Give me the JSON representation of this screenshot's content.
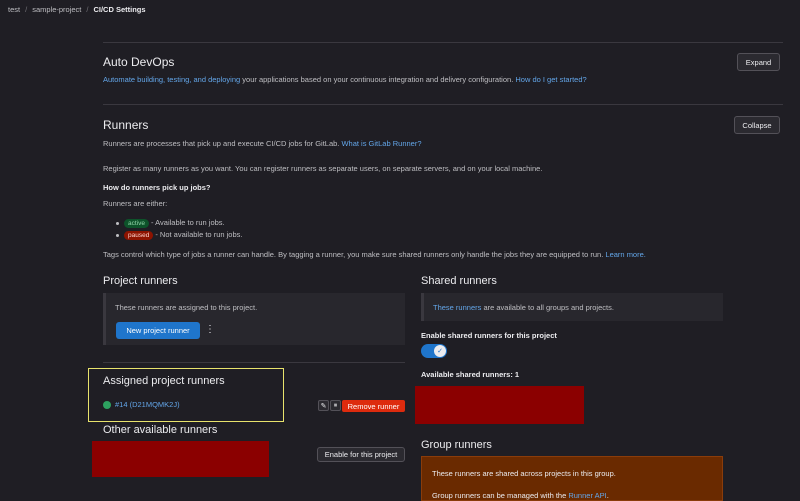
{
  "breadcrumb": {
    "items": [
      "test",
      "sample-project"
    ],
    "current": "CI/CD Settings",
    "separator": "/"
  },
  "auto_devops": {
    "title": "Auto DevOps",
    "desc_link": "Automate building, testing, and deploying",
    "desc_rest": " your applications based on your continuous integration and delivery configuration.",
    "help_link": "How do I get started?",
    "expand_label": "Expand"
  },
  "runners": {
    "title": "Runners",
    "desc": "Runners are processes that pick up and execute CI/CD jobs for GitLab.",
    "desc_link": "What is GitLab Runner?",
    "collapse_label": "Collapse",
    "register_text": "Register as many runners as you want. You can register runners as separate users, on separate servers, and on your local machine.",
    "how_heading": "How do runners pick up jobs?",
    "either_text": "Runners are either:",
    "active_badge": "active",
    "active_text": "- Available to run jobs.",
    "paused_badge": "paused",
    "paused_text": "- Not available to run jobs.",
    "tags_text": "Tags control which type of jobs a runner can handle. By tagging a runner, you make sure shared runners only handle the jobs they are equipped to run.",
    "learn_more": "Learn more."
  },
  "project_runners": {
    "title": "Project runners",
    "panel_text": "These runners are assigned to this project.",
    "new_button": "New project runner",
    "kebab": "⋮"
  },
  "assigned": {
    "title": "Assigned project runners",
    "runner_label": "#14 (D21MQMK2J)",
    "edit_icon": "✎",
    "pause_icon": "⏸",
    "remove_label": "Remove runner"
  },
  "other": {
    "title": "Other available runners",
    "enable_label": "Enable for this project"
  },
  "shared_runners": {
    "title": "Shared runners",
    "panel_link": "These runners",
    "panel_rest": " are available to all groups and projects.",
    "enable_label": "Enable shared runners for this project",
    "toggle_on": true,
    "toggle_icon": "✓",
    "available_label": "Available shared runners: 1"
  },
  "group_runners": {
    "title": "Group runners",
    "text1": "These runners are shared across projects in this group.",
    "text2": "Group runners can be managed with the ",
    "text2_link": "Runner API",
    "text2_end": "."
  },
  "colors": {
    "background": "#1f1e24",
    "link": "#63a6e9",
    "primary": "#1f75cb",
    "danger": "#dd2b0e",
    "highlight": "#e8e36c",
    "redaction": "#8b0000",
    "status_online": "#2da160"
  }
}
